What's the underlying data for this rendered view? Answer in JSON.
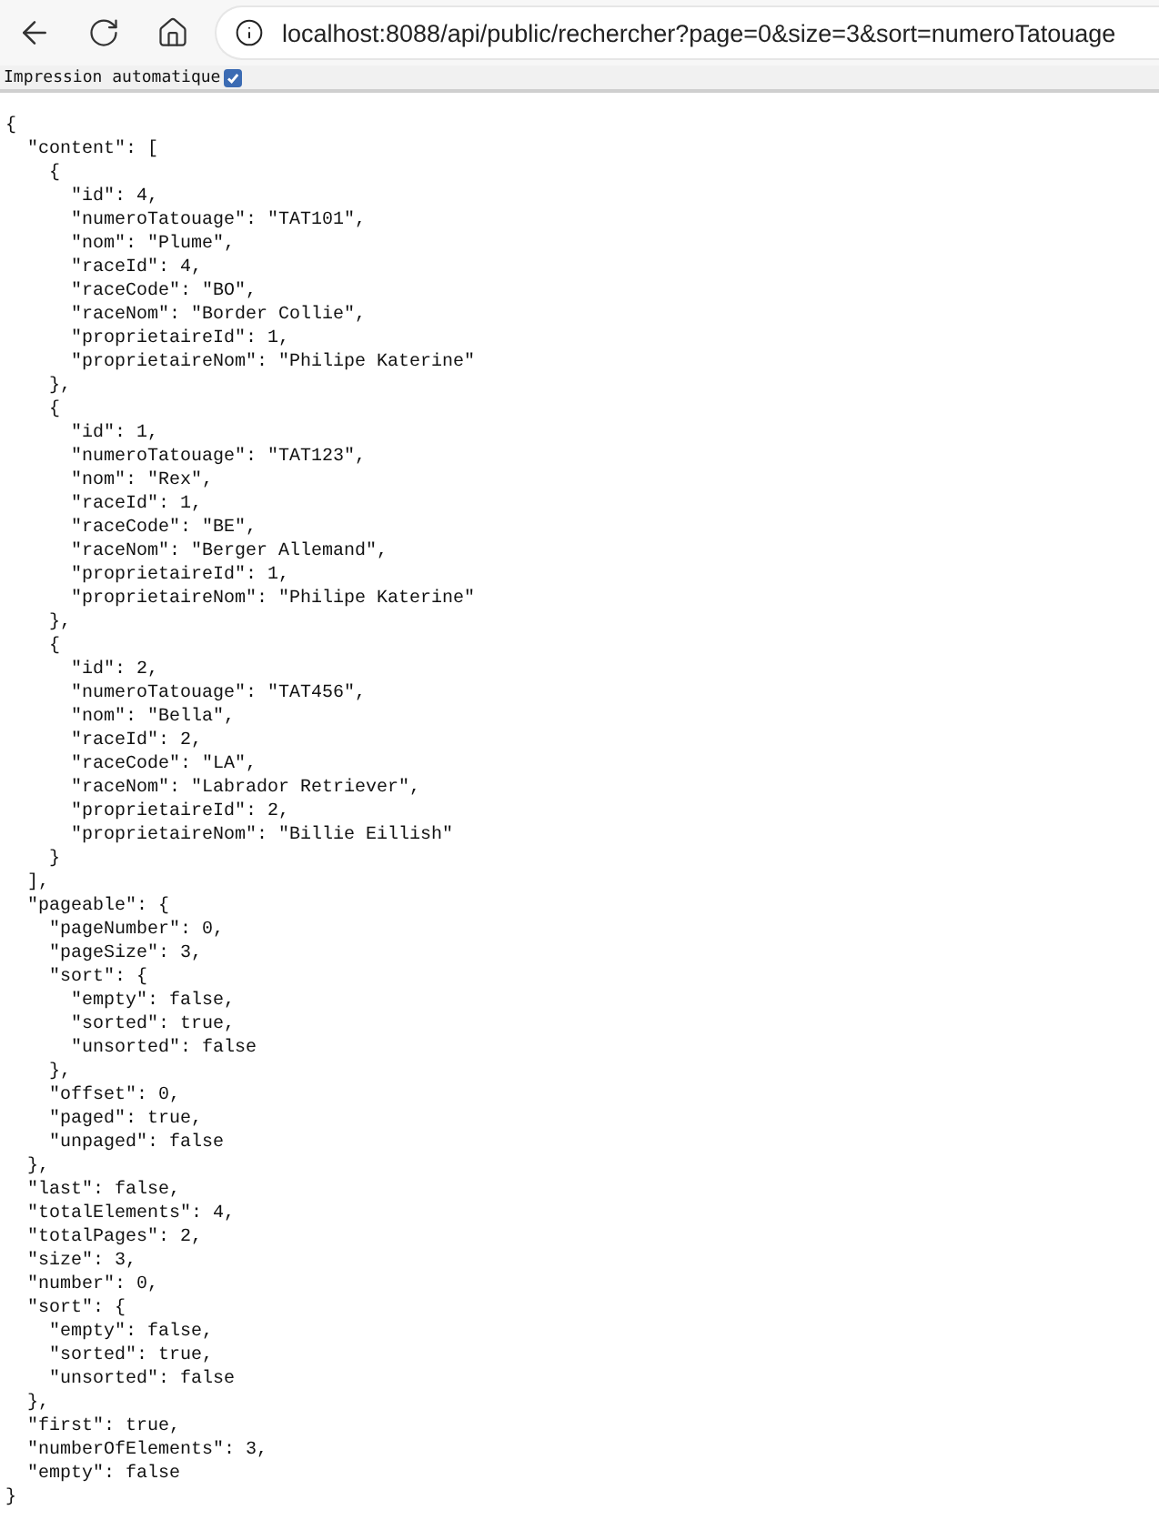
{
  "browser": {
    "url": "localhost:8088/api/public/rechercher?page=0&size=3&sort=numeroTatouage"
  },
  "print_bar": {
    "label": "Impression automatique",
    "checked": true
  },
  "body": [
    {
      "text": "{",
      "children": [
        {
          "text": "\"content\": [",
          "children": [
            {
              "text": "{",
              "children": [
                {
                  "text": "\"id\": 4,"
                },
                {
                  "text": "\"numeroTatouage\": \"TAT101\","
                },
                {
                  "text": "\"nom\": \"Plume\","
                },
                {
                  "text": "\"raceId\": 4,"
                },
                {
                  "text": "\"raceCode\": \"BO\","
                },
                {
                  "text": "\"raceNom\": \"Border Collie\","
                },
                {
                  "text": "\"proprietaireId\": 1,"
                },
                {
                  "text": "\"proprietaireNom\": \"Philipe Katerine\""
                }
              ]
            },
            {
              "text": "},"
            },
            {
              "text": "{",
              "children": [
                {
                  "text": "\"id\": 1,"
                },
                {
                  "text": "\"numeroTatouage\": \"TAT123\","
                },
                {
                  "text": "\"nom\": \"Rex\","
                },
                {
                  "text": "\"raceId\": 1,"
                },
                {
                  "text": "\"raceCode\": \"BE\","
                },
                {
                  "text": "\"raceNom\": \"Berger Allemand\","
                },
                {
                  "text": "\"proprietaireId\": 1,"
                },
                {
                  "text": "\"proprietaireNom\": \"Philipe Katerine\""
                }
              ]
            },
            {
              "text": "},"
            },
            {
              "text": "{",
              "children": [
                {
                  "text": "\"id\": 2,"
                },
                {
                  "text": "\"numeroTatouage\": \"TAT456\","
                },
                {
                  "text": "\"nom\": \"Bella\","
                },
                {
                  "text": "\"raceId\": 2,"
                },
                {
                  "text": "\"raceCode\": \"LA\","
                },
                {
                  "text": "\"raceNom\": \"Labrador Retriever\","
                },
                {
                  "text": "\"proprietaireId\": 2,"
                },
                {
                  "text": "\"proprietaireNom\": \"Billie Eillish\""
                }
              ]
            },
            {
              "text": "}"
            }
          ]
        },
        {
          "text": "],"
        },
        {
          "text": "\"pageable\": {",
          "children": [
            {
              "text": "\"pageNumber\": 0,"
            },
            {
              "text": "\"pageSize\": 3,"
            },
            {
              "text": "\"sort\": {",
              "children": [
                {
                  "text": "\"empty\": false,"
                },
                {
                  "text": "\"sorted\": true,"
                },
                {
                  "text": "\"unsorted\": false"
                }
              ]
            },
            {
              "text": "},"
            },
            {
              "text": "\"offset\": 0,"
            },
            {
              "text": "\"paged\": true,"
            },
            {
              "text": "\"unpaged\": false"
            }
          ]
        },
        {
          "text": "},"
        },
        {
          "text": "\"last\": false,"
        },
        {
          "text": "\"totalElements\": 4,"
        },
        {
          "text": "\"totalPages\": 2,"
        },
        {
          "text": "\"size\": 3,"
        },
        {
          "text": "\"number\": 0,"
        },
        {
          "text": "\"sort\": {",
          "children": [
            {
              "text": "\"empty\": false,"
            },
            {
              "text": "\"sorted\": true,"
            },
            {
              "text": "\"unsorted\": false"
            }
          ]
        },
        {
          "text": "},"
        },
        {
          "text": "\"first\": true,"
        },
        {
          "text": "\"numberOfElements\": 3,"
        },
        {
          "text": "\"empty\": false"
        }
      ]
    },
    {
      "text": "}"
    }
  ]
}
